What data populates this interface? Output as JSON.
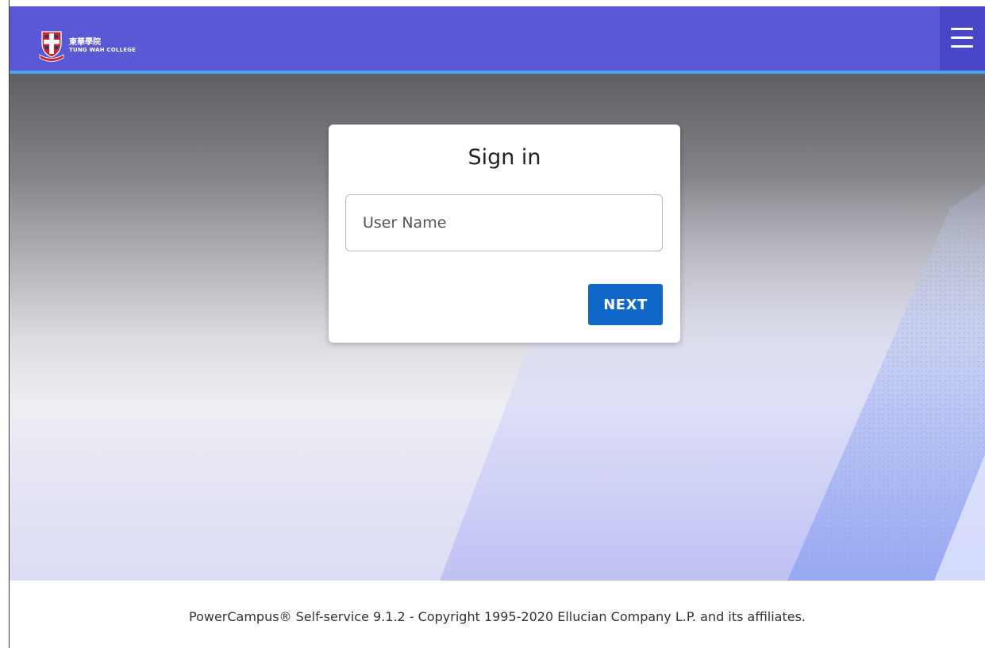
{
  "header": {
    "logo_cn": "東華學院",
    "logo_en": "TUNG WAH COLLEGE",
    "menu_icon": "hamburger-icon"
  },
  "signin": {
    "title": "Sign in",
    "username_placeholder": "User Name",
    "username_value": "",
    "next_label": "NEXT"
  },
  "footer": {
    "text": "PowerCampus® Self-service 9.1.2 - Copyright 1995-2020 Ellucian Company L.P. and its affiliates."
  },
  "colors": {
    "header": "#5a58d4",
    "header_accent": "#4aa3f0",
    "menu_button": "#4845c7",
    "primary_button": "#0f68c7"
  }
}
